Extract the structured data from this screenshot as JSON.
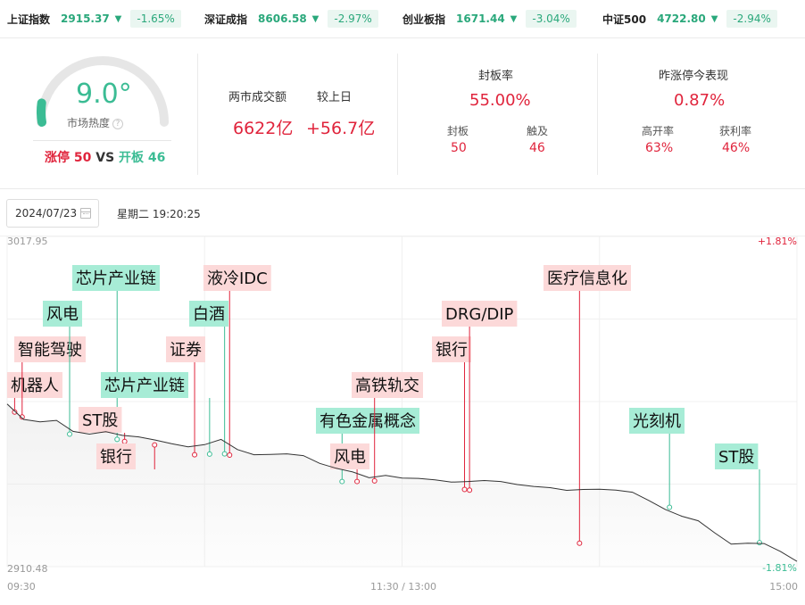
{
  "indices": [
    {
      "name": "上证指数",
      "value": "2915.37",
      "arrow": "▼",
      "change": "-1.65%"
    },
    {
      "name": "深证成指",
      "value": "8606.58",
      "arrow": "▼",
      "change": "-2.97%"
    },
    {
      "name": "创业板指",
      "value": "1671.44",
      "arrow": "▼",
      "change": "-3.04%"
    },
    {
      "name": "中证500",
      "value": "4722.80",
      "arrow": "▼",
      "change": "-2.94%"
    }
  ],
  "heat": {
    "value": "9.0°",
    "level": 0.09,
    "label": "市场热度",
    "help_icon": "?",
    "limit_up_label": "涨停",
    "limit_up_count": "50",
    "vs": "VS",
    "open_label": "开板",
    "open_count": "46"
  },
  "turnover": {
    "label": "两市成交额",
    "value": "6622亿",
    "compare_label": "较上日",
    "compare_value": "+56.7亿"
  },
  "seal_rate": {
    "label": "封板率",
    "value": "55.00%",
    "sealed_label": "封板",
    "sealed_value": "50",
    "touched_label": "触及",
    "touched_value": "46"
  },
  "yesterday": {
    "label": "昨涨停今表现",
    "value": "0.87%",
    "high_open_label": "高开率",
    "high_open_value": "63%",
    "profit_label": "获利率",
    "profit_value": "46%"
  },
  "date_picker": {
    "value": "2024/07/23",
    "icon": "calendar-icon"
  },
  "weekday_time": "星期二 19:20:25",
  "chart_data": {
    "type": "line",
    "y_top_label": "3017.95",
    "y_bottom_label": "2910.48",
    "ylim": [
      2910.48,
      3017.95
    ],
    "pct_top_label": "+1.81%",
    "pct_bottom_label": "-1.81%",
    "x_labels": [
      "09:30",
      "11:30 / 13:00",
      "15:00"
    ],
    "colors": {
      "line": "#333333",
      "up": "#e0243c",
      "down": "#3bbc94",
      "up_bg": "#fcd9d9",
      "down_bg": "#a7ecd6"
    },
    "series": [
      {
        "x": [
          0,
          5,
          10,
          15,
          20,
          25,
          30,
          35,
          40,
          45,
          50,
          55,
          60,
          65,
          70,
          75,
          80,
          85,
          90,
          95,
          100,
          105,
          110,
          115,
          120,
          125,
          130,
          135,
          140,
          145,
          150,
          155,
          160,
          165,
          170,
          175,
          180,
          185,
          190,
          195,
          200,
          205,
          210,
          215,
          220,
          225,
          230,
          235,
          240
        ],
        "values": [
          2963.4,
          2958.4,
          2957.6,
          2958.1,
          2954.5,
          2953.6,
          2954.4,
          2953.2,
          2952.7,
          2951.7,
          2950.5,
          2949.5,
          2950.2,
          2951.9,
          2948.6,
          2946.9,
          2947.0,
          2947.2,
          2946.6,
          2944.1,
          2942.5,
          2941.3,
          2939.4,
          2940.2,
          2939.3,
          2939.2,
          2938.7,
          2938.0,
          2938.2,
          2938.5,
          2938.2,
          2937.2,
          2936.6,
          2936.2,
          2935.3,
          2935.6,
          2935.7,
          2935.4,
          2934.7,
          2932.0,
          2929.1,
          2926.9,
          2925.4,
          2921.5,
          2917.8,
          2918.1,
          2918.0,
          2915.4,
          2912.2
        ]
      }
    ],
    "tags": [
      {
        "label": "机器人",
        "x": 3,
        "value": 2960.8,
        "dir": "up"
      },
      {
        "label": "智能驾驶",
        "x": 6,
        "value": 2959.2,
        "dir": "up"
      },
      {
        "label": "风电",
        "x": 25,
        "value": 2953.6,
        "dir": "down"
      },
      {
        "label": "芯片产业链",
        "x": 44,
        "value": 2951.9,
        "dir": "down"
      },
      {
        "label": "ST股",
        "x": 47,
        "value": 2951.2,
        "dir": "up"
      },
      {
        "label": "银行",
        "x": 59,
        "value": 2950.1,
        "dir": "up"
      },
      {
        "label": "证券",
        "x": 75,
        "value": 2946.9,
        "dir": "up"
      },
      {
        "label": "芯片产业链",
        "x": 81,
        "value": 2947.1,
        "dir": "down"
      },
      {
        "label": "白酒",
        "x": 87,
        "value": 2947.2,
        "dir": "down"
      },
      {
        "label": "液冷IDC",
        "x": 89,
        "value": 2946.8,
        "dir": "up"
      },
      {
        "label": "有色金属概念",
        "x": 134,
        "value": 2938.2,
        "dir": "down"
      },
      {
        "label": "风电",
        "x": 140,
        "value": 2938.2,
        "dir": "up"
      },
      {
        "label": "高铁轨交",
        "x": 147,
        "value": 2938.4,
        "dir": "up"
      },
      {
        "label": "银行",
        "x": 183,
        "value": 2935.6,
        "dir": "up"
      },
      {
        "label": "DRG/DIP",
        "x": 185,
        "value": 2935.4,
        "dir": "up"
      },
      {
        "label": "医疗信息化",
        "x": 229,
        "value": 2918.1,
        "dir": "up"
      },
      {
        "label": "光刻机",
        "x": 265,
        "value": 2929.8,
        "dir": "down"
      },
      {
        "label": "ST股",
        "x": 301,
        "value": 2918.3,
        "dir": "down"
      }
    ]
  }
}
